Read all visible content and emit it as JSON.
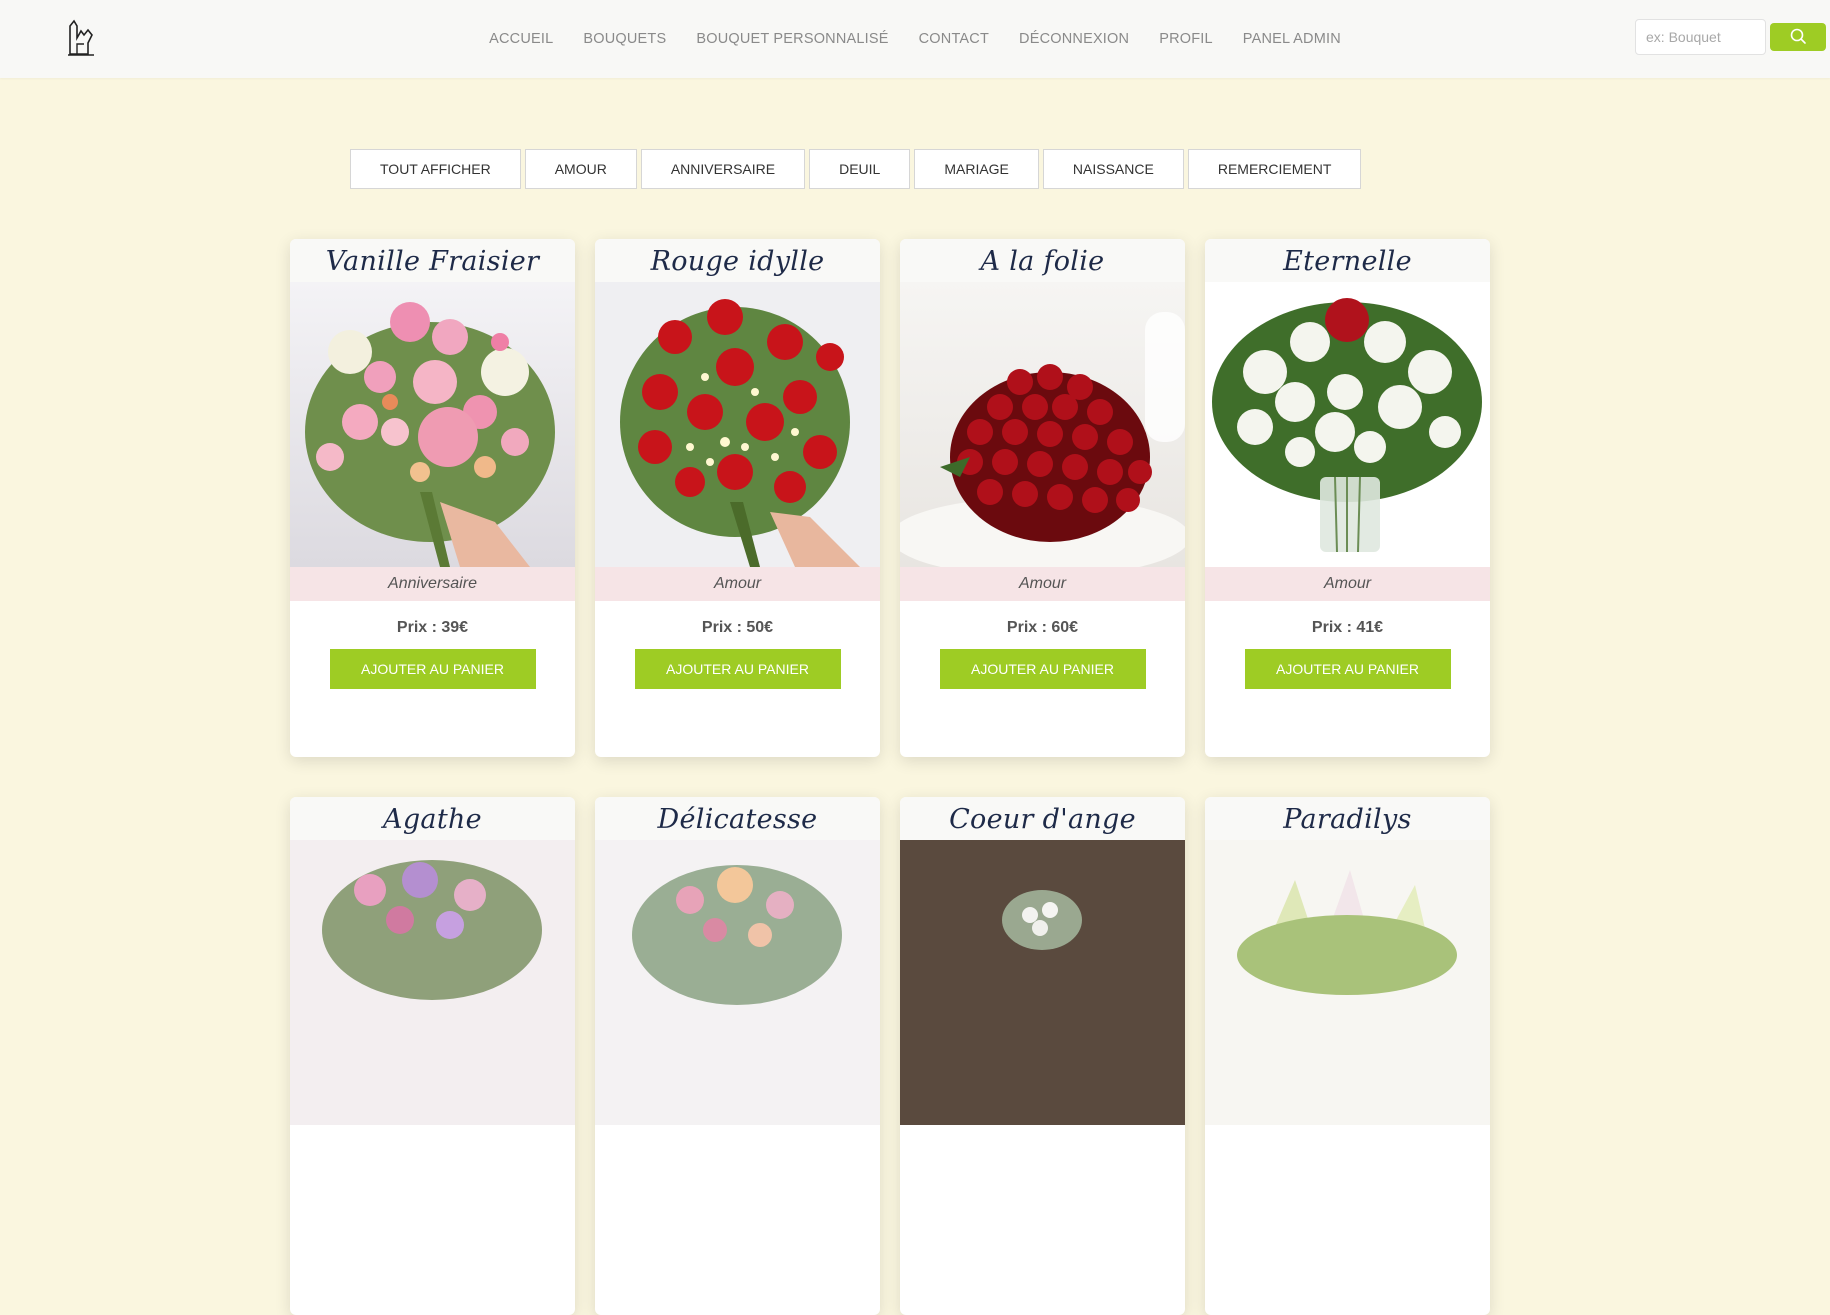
{
  "nav": {
    "items": [
      {
        "label": "ACCUEIL"
      },
      {
        "label": "BOUQUETS"
      },
      {
        "label": "BOUQUET PERSONNALISÉ"
      },
      {
        "label": "CONTACT"
      },
      {
        "label": "DÉCONNEXION"
      },
      {
        "label": "PROFIL"
      },
      {
        "label": "PANEL ADMIN"
      }
    ]
  },
  "search": {
    "placeholder": "ex: Bouquet",
    "icon": "search-icon"
  },
  "filters": [
    {
      "label": "TOUT AFFICHER"
    },
    {
      "label": "AMOUR"
    },
    {
      "label": "ANNIVERSAIRE"
    },
    {
      "label": "DEUIL"
    },
    {
      "label": "MARIAGE"
    },
    {
      "label": "NAISSANCE"
    },
    {
      "label": "REMERCIEMENT"
    }
  ],
  "products": [
    {
      "name": "Vanille Fraisier",
      "category": "Anniversaire",
      "price": "Prix : 39€",
      "button": "AJOUTER AU PANIER"
    },
    {
      "name": "Rouge idylle",
      "category": "Amour",
      "price": "Prix : 50€",
      "button": "AJOUTER AU PANIER"
    },
    {
      "name": "A la folie",
      "category": "Amour",
      "price": "Prix : 60€",
      "button": "AJOUTER AU PANIER"
    },
    {
      "name": "Eternelle",
      "category": "Amour",
      "price": "Prix : 41€",
      "button": "AJOUTER AU PANIER"
    },
    {
      "name": "Agathe"
    },
    {
      "name": "Délicatesse"
    },
    {
      "name": "Coeur d'ange"
    },
    {
      "name": "Paradilys"
    }
  ],
  "colors": {
    "accent": "#9ecc24",
    "background": "#faf6df",
    "title": "#1e2a48",
    "category_bg": "#f6e4e6"
  }
}
